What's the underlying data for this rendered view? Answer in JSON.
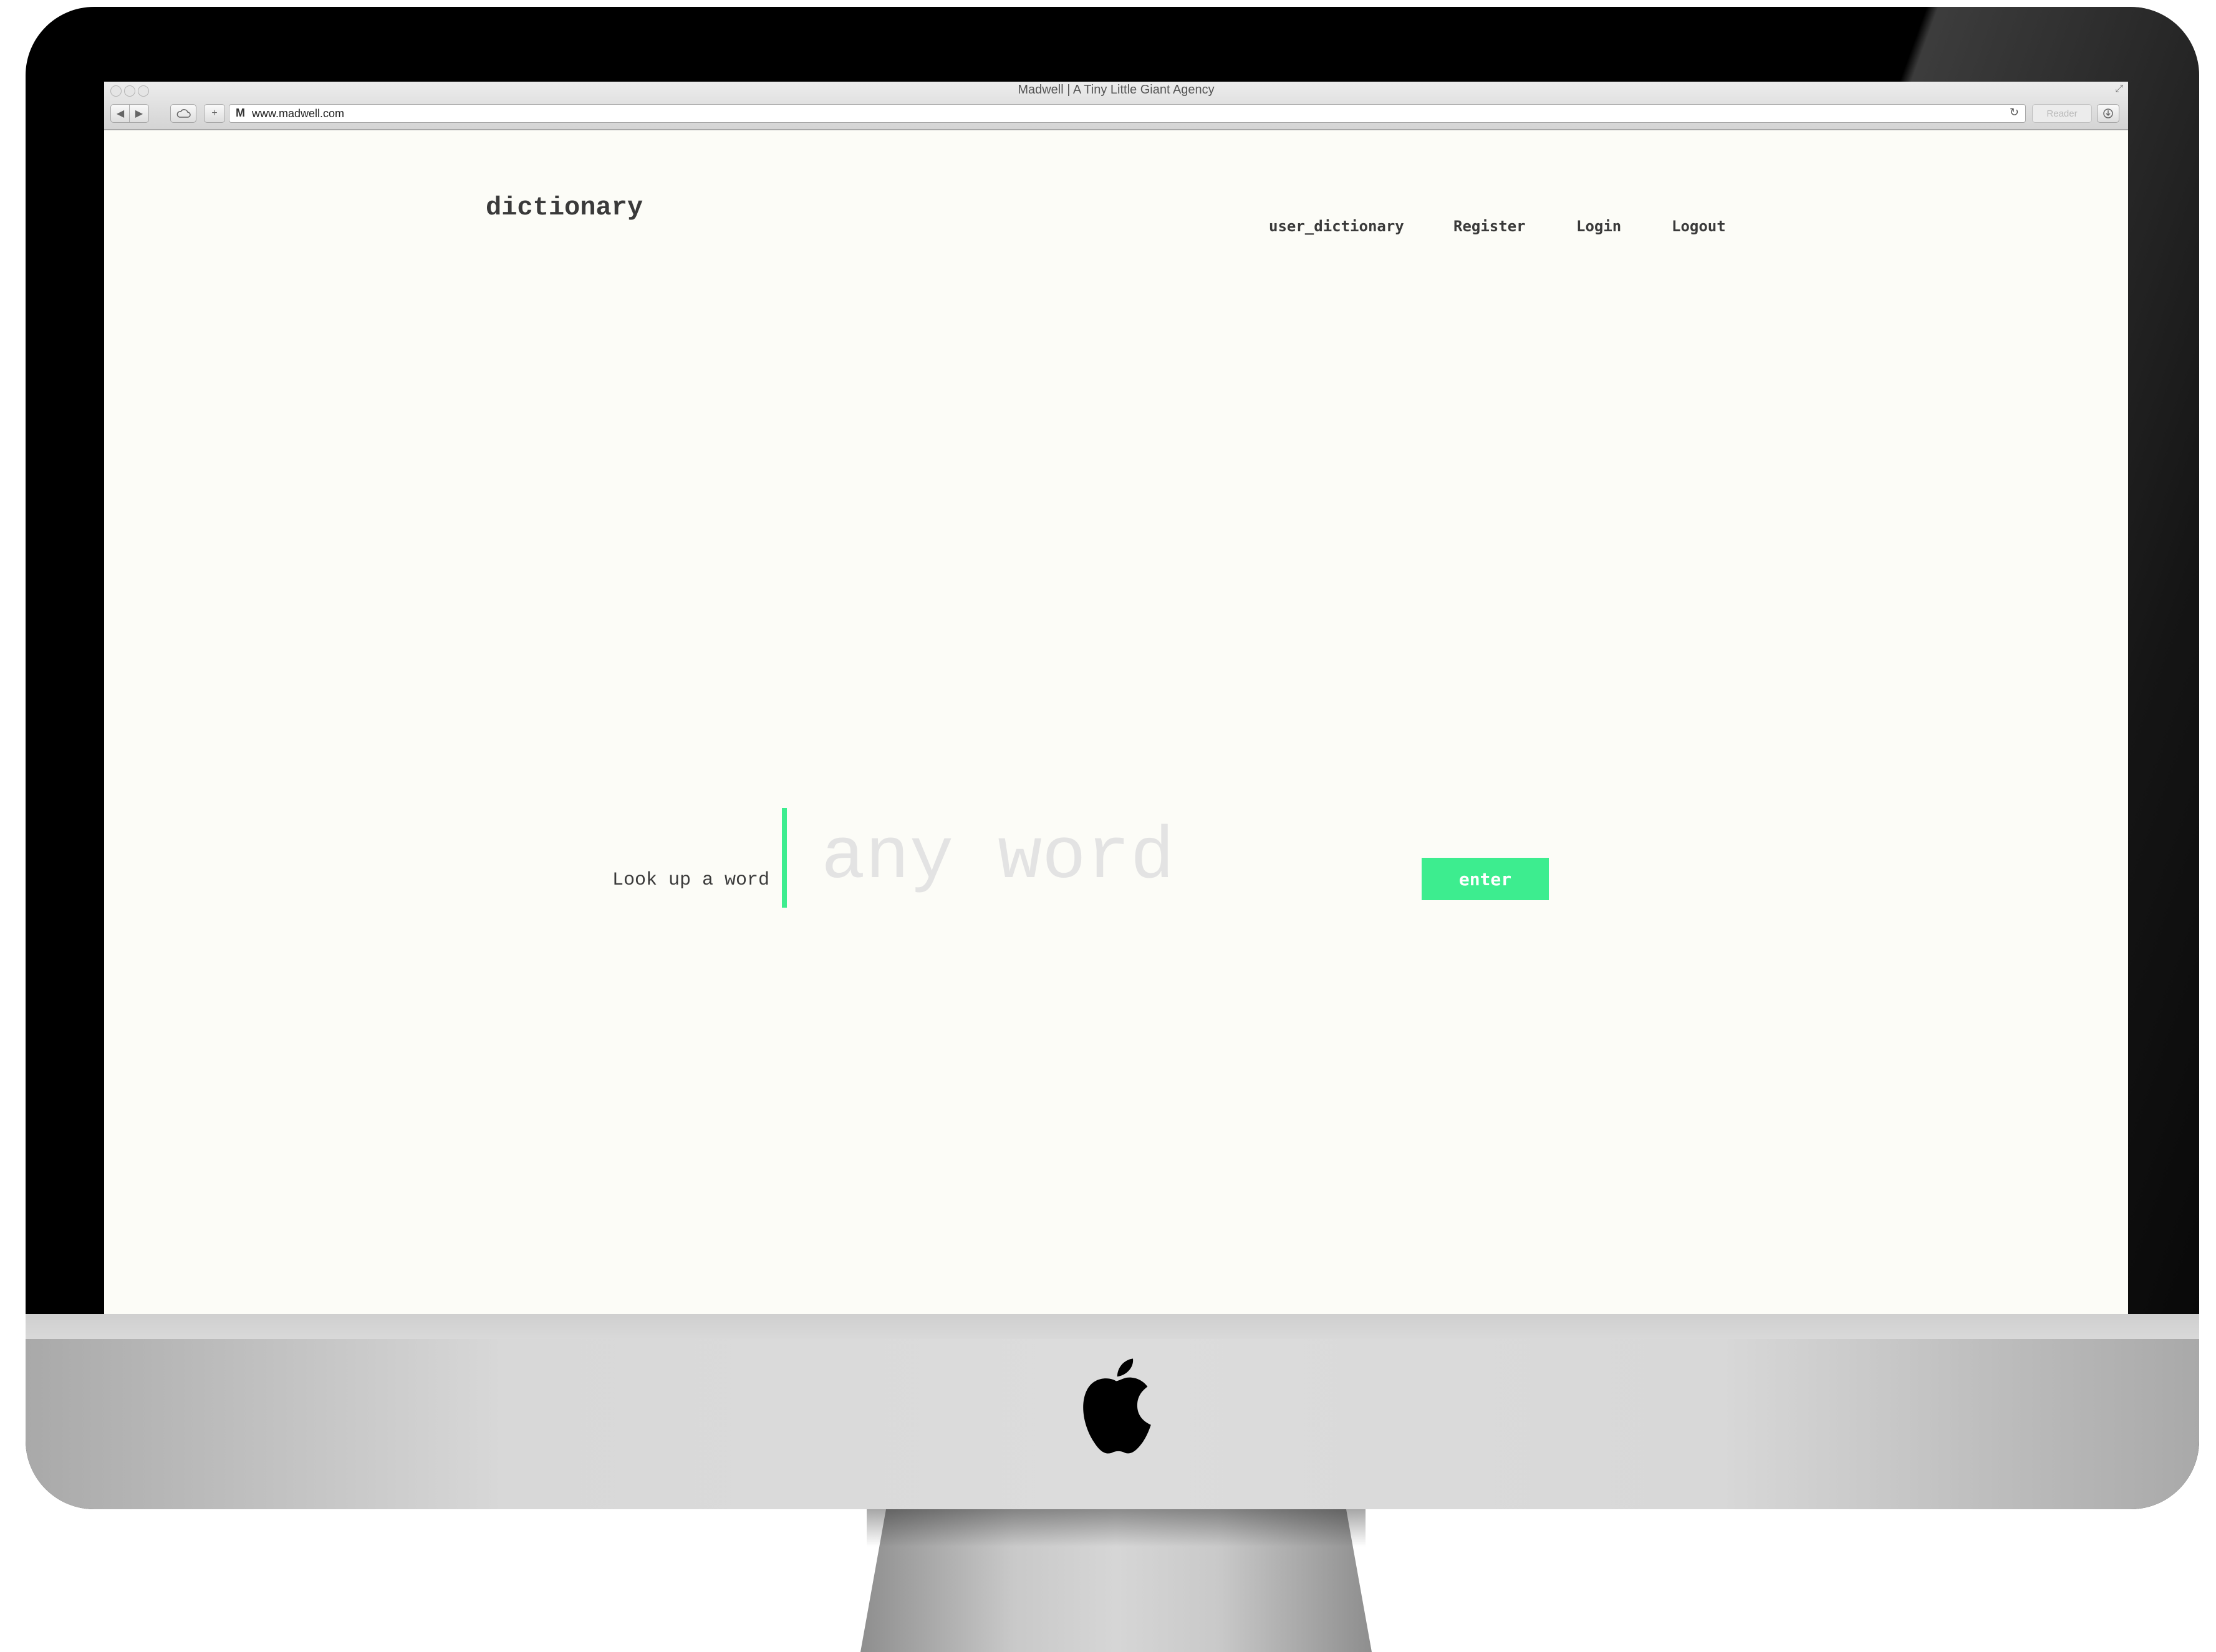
{
  "browser": {
    "window_title": "Madwell | A Tiny Little Giant Agency",
    "url": "www.madwell.com",
    "favicon_letter": "M",
    "reader_label": "Reader",
    "back_icon": "◀",
    "forward_icon": "▶",
    "reload_icon": "↻",
    "new_tab_icon": "+"
  },
  "site": {
    "brand": "dictionary",
    "nav": [
      {
        "label": "user_dictionary"
      },
      {
        "label": "Register"
      },
      {
        "label": "Login"
      },
      {
        "label": "Logout"
      }
    ]
  },
  "search": {
    "label": "Look up a word",
    "placeholder": "any word",
    "value": "",
    "button_label": "enter"
  },
  "colors": {
    "accent": "#3ded8f",
    "page_background": "#fcfcf7",
    "text": "#3a3a3a"
  }
}
